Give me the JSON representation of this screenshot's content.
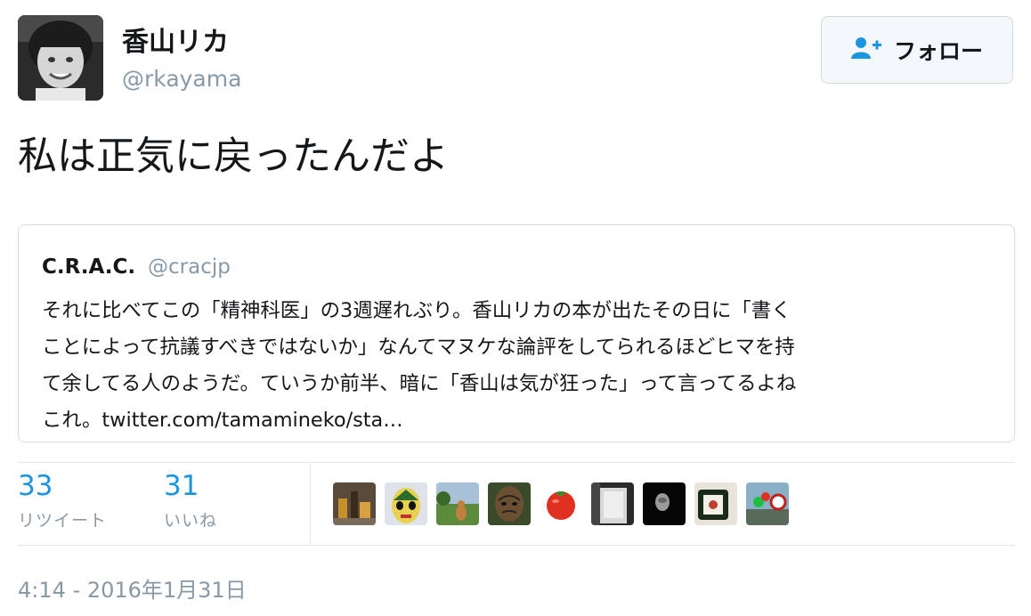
{
  "author": {
    "name": "香山リカ",
    "handle": "@rkayama"
  },
  "follow_button": {
    "label": "フォロー",
    "icon": "add-user-icon"
  },
  "tweet": {
    "text": "私は正気に戻ったんだよ"
  },
  "quoted_tweet": {
    "name": "C.R.A.C.",
    "handle": "@cracjp",
    "lines": [
      "それに比べてこの「精神科医」の3週遅れぶり。香山リカの本が出たその日に「書く",
      "ことによって抗議すべきではないか」なんてマヌケな論評をしてられるほどヒマを持",
      "て余してる人のようだ。ていうか前半、暗に「香山は気が狂った」って言ってるよね",
      "これ。twitter.com/tamamineko/sta…"
    ]
  },
  "stats": {
    "retweets": {
      "count": "33",
      "label": "リツイート"
    },
    "likes": {
      "count": "31",
      "label": "いいね"
    }
  },
  "likers": [
    "liker-avatar-1",
    "liker-avatar-2",
    "liker-avatar-3",
    "liker-avatar-4",
    "liker-avatar-5",
    "liker-avatar-6",
    "liker-avatar-7",
    "liker-avatar-8",
    "liker-avatar-9"
  ],
  "timestamp": "4:14 - 2016年1月31日",
  "colors": {
    "accent": "#1b95e0",
    "muted": "#8899a6",
    "border": "#e1e8ed",
    "text": "#14171a"
  }
}
